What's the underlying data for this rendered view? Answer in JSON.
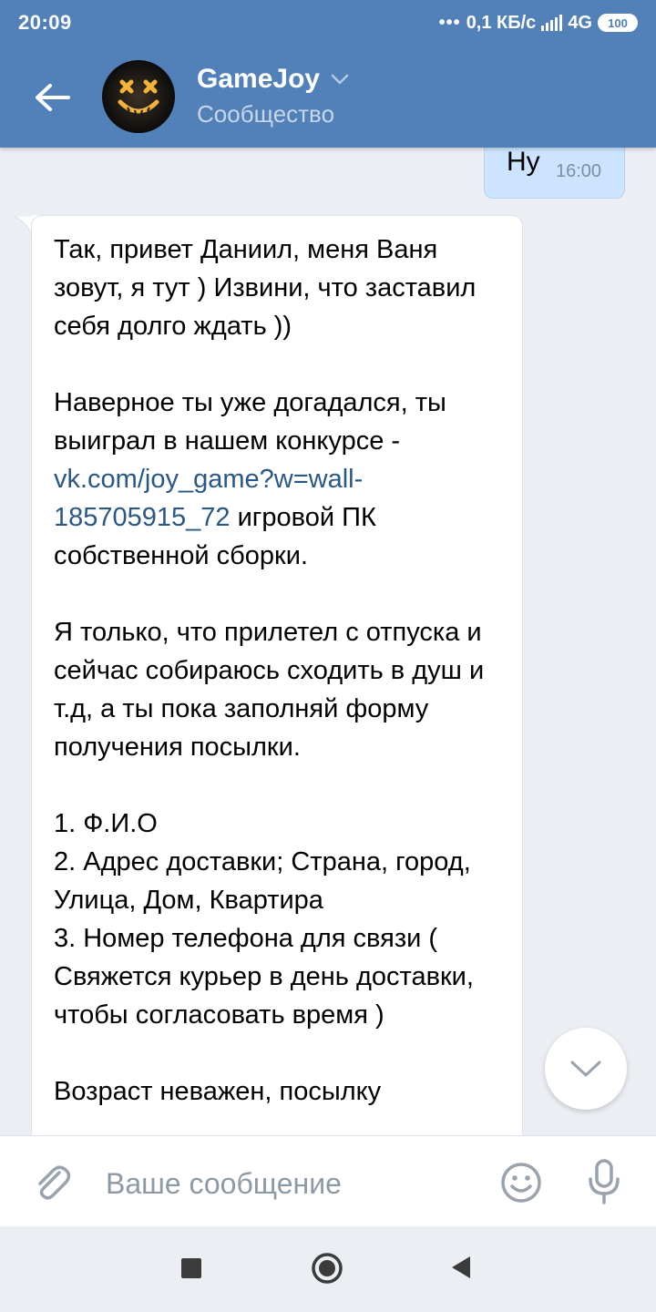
{
  "status_bar": {
    "time": "20:09",
    "network_speed": "0,1 КБ/с",
    "network_type": "4G",
    "battery": "100"
  },
  "header": {
    "title": "GameJoy",
    "subtitle": "Сообщество"
  },
  "messages": {
    "outgoing": {
      "text": "Ну",
      "time": "16:00"
    },
    "incoming": {
      "p1": "Так, привет Даниил, меня Ваня зовут, я тут ) Извини, что заставил себя долго ждать ))",
      "p2_before_link": "Наверное ты уже догадался, ты выиграл в нашем конкурсе - ",
      "p2_link": "vk.com/joy_game?w=wall-185705915_72",
      "p2_after_link": " игровой ПК собственной сборки.",
      "p3": "Я только, что прилетел с отпуска и сейчас собираюсь сходить в душ и т.д, а ты пока заполняй форму получения посылки.",
      "list_1": "1. Ф.И.О",
      "list_2": "2. Адрес доставки; Страна, город, Улица, Дом, Квартира",
      "list_3": "3. Номер телефона для связи ( Свяжется курьер в день доставки, чтобы согласовать время )",
      "p4_partial": "Возраст неважен, посылку"
    }
  },
  "input": {
    "placeholder": "Ваше сообщение"
  },
  "icons": {
    "back": "arrow-left-icon",
    "chevron": "chevron-down-icon",
    "attach": "paperclip-icon",
    "emoji": "smile-icon",
    "mic": "microphone-icon",
    "scroll_down": "chevron-down-icon"
  },
  "colors": {
    "header": "#5181b8",
    "background": "#ebeef2",
    "outgoing_bubble": "#cce4ff",
    "link": "#2a5885"
  }
}
